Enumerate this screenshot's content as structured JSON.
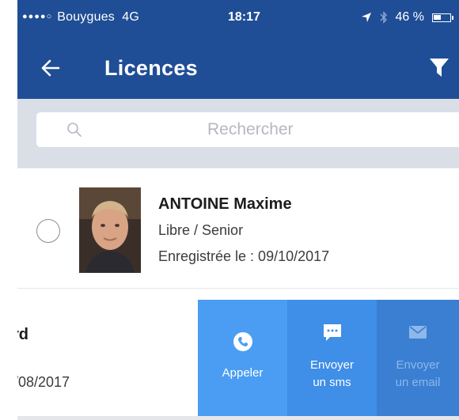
{
  "status_bar": {
    "signal_dots": "●●●●○",
    "carrier": "Bouygues",
    "network": "4G",
    "time": "18:17",
    "battery": "46 %",
    "icons": [
      "location-arrow-icon",
      "bluetooth-icon",
      "battery-icon"
    ]
  },
  "header": {
    "title": "Licences",
    "back_icon": "arrow-left-icon",
    "filter_icon": "funnel-icon",
    "color": "#1f4e96"
  },
  "search": {
    "placeholder": "Rechercher",
    "icon": "search-icon"
  },
  "rows": [
    {
      "name": "ANTOINE Maxime",
      "category": "Libre / Senior",
      "registered": "Enregistrée le : 09/10/2017"
    },
    {
      "name": "rd",
      "registered": "/08/2017",
      "actions": [
        {
          "label_line1": "Appeler",
          "label_line2": "",
          "icon": "phone-icon",
          "color": "#4a9df2"
        },
        {
          "label_line1": "Envoyer",
          "label_line2": "un sms",
          "icon": "chat-bubble-icon",
          "color": "#3f8ee8"
        },
        {
          "label_line1": "Envoyer",
          "label_line2": "un email",
          "icon": "envelope-icon",
          "color": "#3a7fd2"
        }
      ]
    }
  ]
}
